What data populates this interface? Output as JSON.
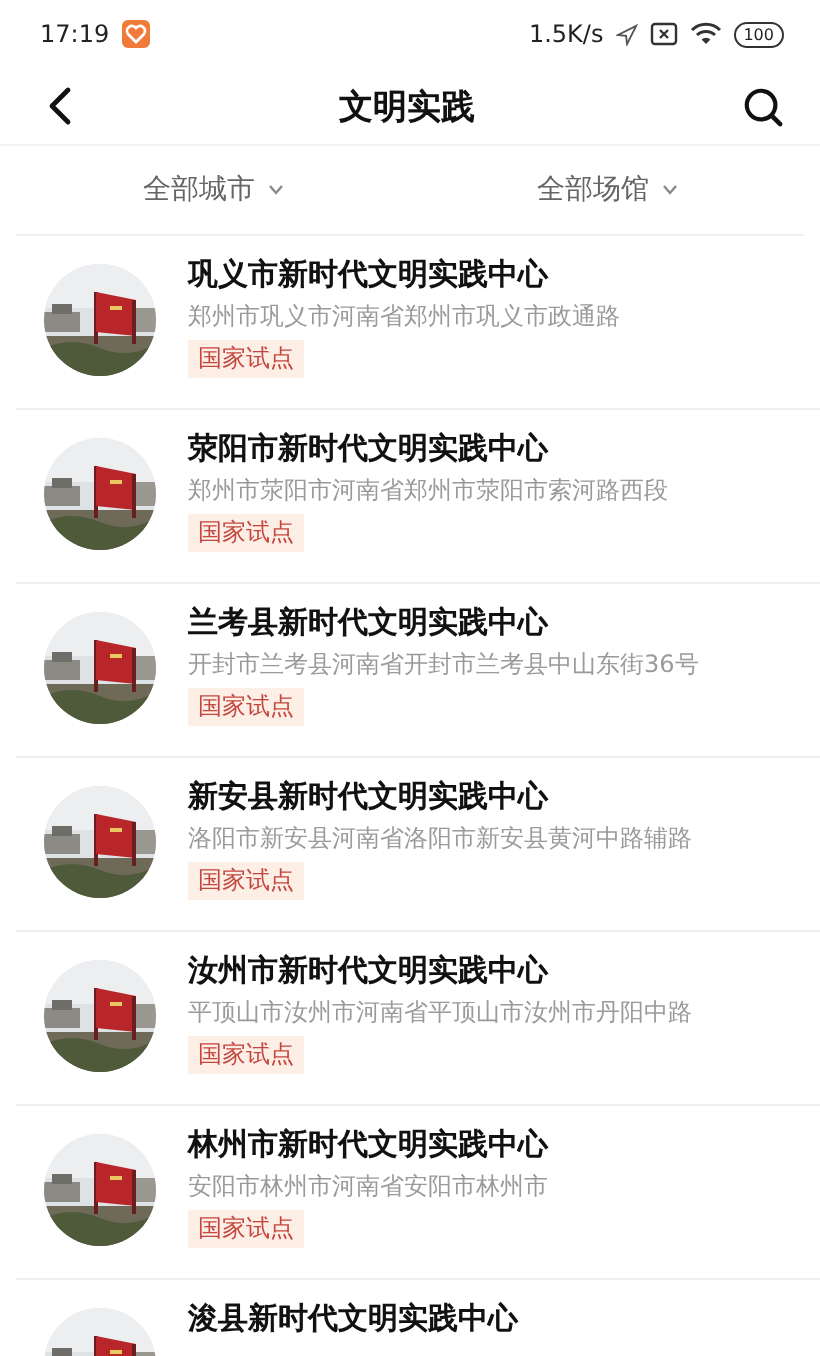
{
  "status_bar": {
    "time": "17:19",
    "speed": "1.5K/s",
    "battery": "100"
  },
  "header": {
    "title": "文明实践"
  },
  "filters": [
    {
      "label": "全部城市"
    },
    {
      "label": "全部场馆"
    }
  ],
  "items": [
    {
      "name": "巩义市新时代文明实践中心",
      "address": "郑州市巩义市河南省郑州市巩义市政通路",
      "tag": "国家试点"
    },
    {
      "name": "荥阳市新时代文明实践中心",
      "address": "郑州市荥阳市河南省郑州市荥阳市索河路西段",
      "tag": "国家试点"
    },
    {
      "name": "兰考县新时代文明实践中心",
      "address": "开封市兰考县河南省开封市兰考县中山东街36号",
      "tag": "国家试点"
    },
    {
      "name": "新安县新时代文明实践中心",
      "address": "洛阳市新安县河南省洛阳市新安县黄河中路辅路",
      "tag": "国家试点"
    },
    {
      "name": "汝州市新时代文明实践中心",
      "address": "平顶山市汝州市河南省平顶山市汝州市丹阳中路",
      "tag": "国家试点"
    },
    {
      "name": "林州市新时代文明实践中心",
      "address": "安阳市林州市河南省安阳市林州市",
      "tag": "国家试点"
    },
    {
      "name": "浚县新时代文明实践中心"
    }
  ]
}
